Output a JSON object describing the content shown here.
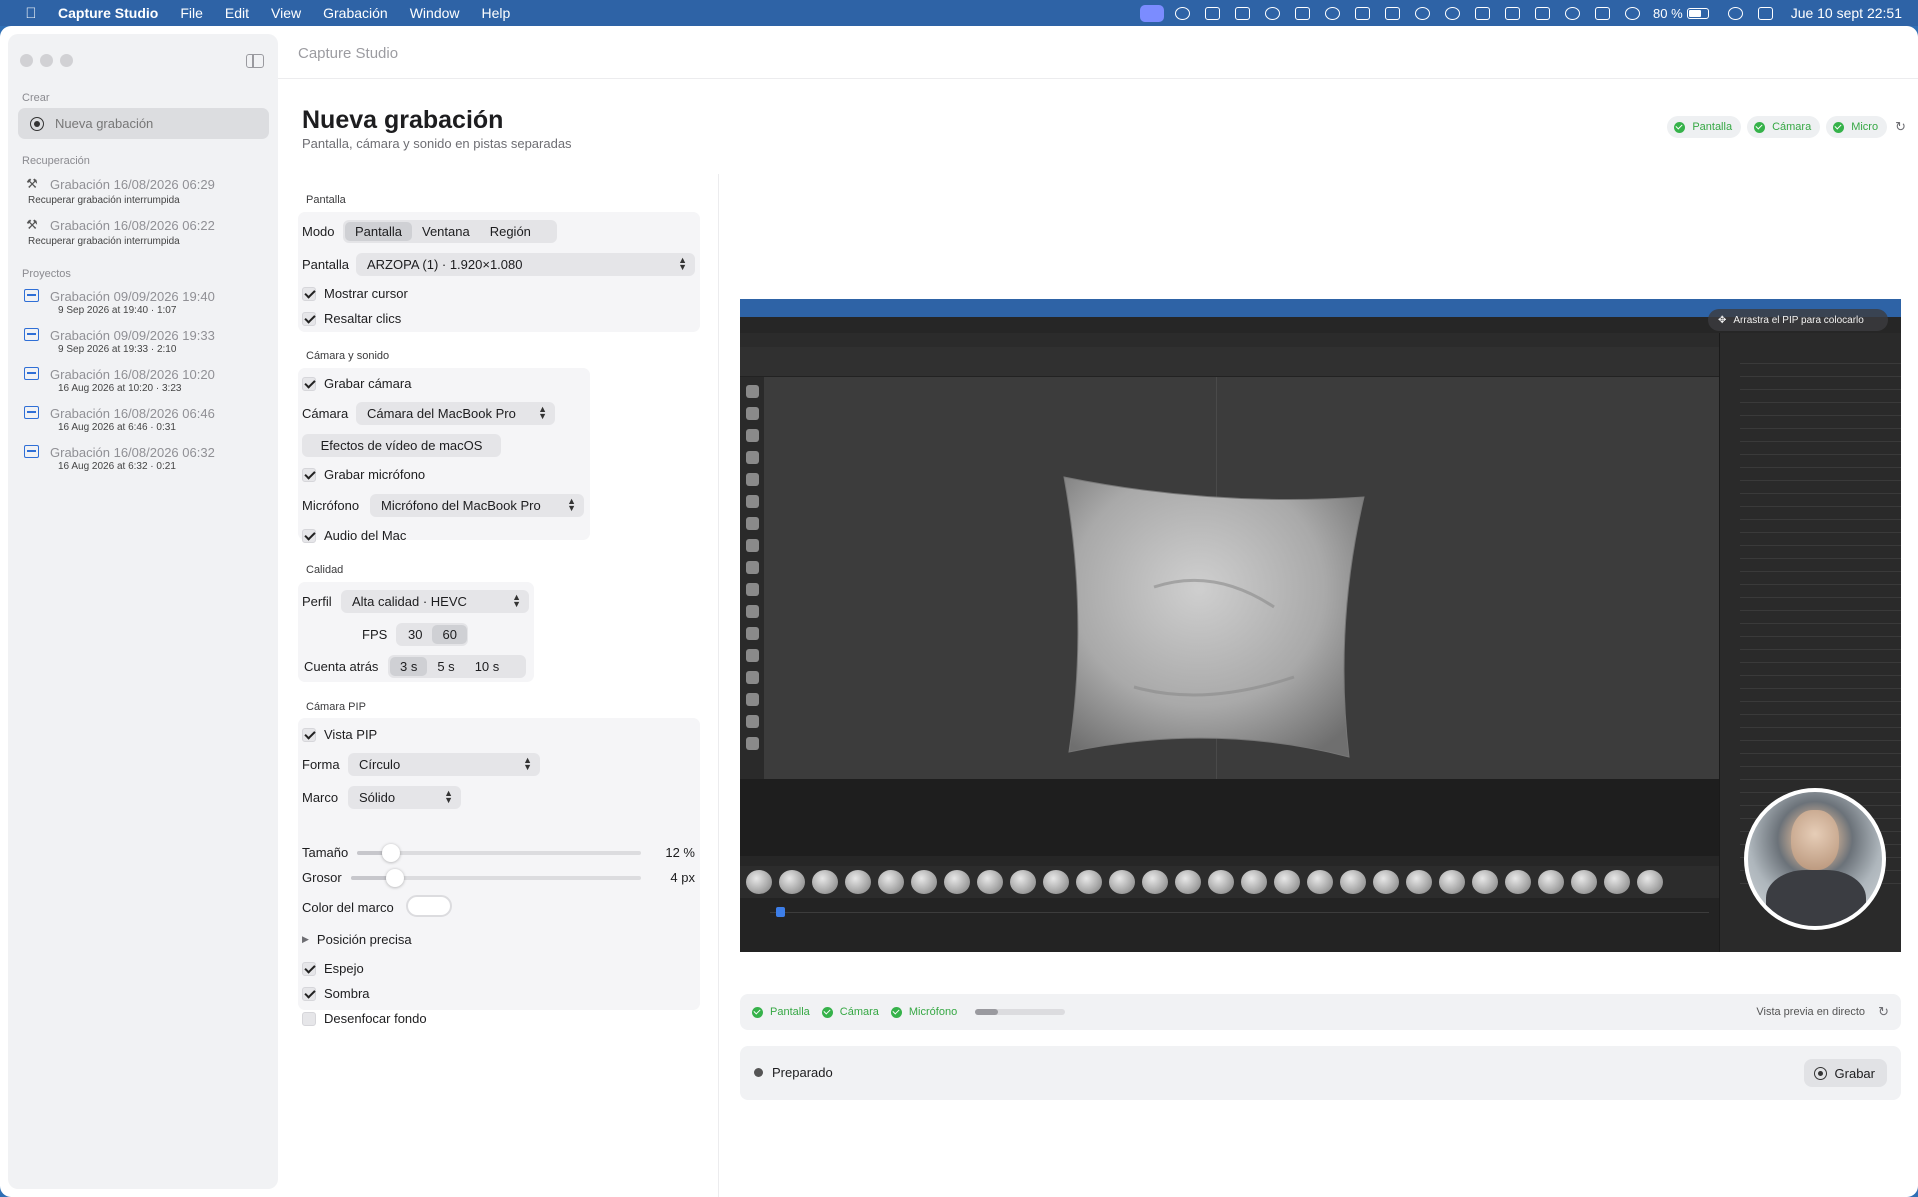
{
  "menubar": {
    "app_name": "Capture Studio",
    "items": [
      "File",
      "Edit",
      "View",
      "Grabación",
      "Window",
      "Help"
    ],
    "battery": "80 %",
    "clock": "Jue 10 sept 22:51"
  },
  "window": {
    "title": "Capture Studio"
  },
  "sidebar": {
    "create_label": "Crear",
    "new_recording": "Nueva grabación",
    "recovery_label": "Recuperación",
    "recovery": [
      {
        "title": "Grabación 16/08/2026 06:29",
        "subtitle": "Recuperar grabación interrumpida"
      },
      {
        "title": "Grabación 16/08/2026 06:22",
        "subtitle": "Recuperar grabación interrumpida"
      }
    ],
    "projects_label": "Proyectos",
    "projects": [
      {
        "title": "Grabación 09/09/2026 19:40",
        "subtitle": "9 Sep 2026 at 19:40 · 1:07"
      },
      {
        "title": "Grabación 09/09/2026 19:33",
        "subtitle": "9 Sep 2026 at 19:33 · 2:10"
      },
      {
        "title": "Grabación 16/08/2026 10:20",
        "subtitle": "16 Aug 2026 at 10:20 · 3:23"
      },
      {
        "title": "Grabación 16/08/2026 06:46",
        "subtitle": "16 Aug 2026 at 6:46 · 0:31"
      },
      {
        "title": "Grabación 16/08/2026 06:32",
        "subtitle": "16 Aug 2026 at 6:32 · 0:21"
      }
    ]
  },
  "header": {
    "title": "Nueva grabación",
    "subtitle": "Pantalla, cámara y sonido en pistas separadas",
    "chips": [
      "Pantalla",
      "Cámara",
      "Micro"
    ]
  },
  "screen": {
    "section": "Pantalla",
    "mode_label": "Modo",
    "modes": [
      "Pantalla",
      "Ventana",
      "Región"
    ],
    "mode_selected": "Pantalla",
    "display_label": "Pantalla",
    "display_value": "ARZOPA (1) · 1.920×1.080",
    "show_cursor": "Mostrar cursor",
    "highlight_clicks": "Resaltar clics"
  },
  "camera_sound": {
    "section": "Cámara y sonido",
    "record_camera": "Grabar cámara",
    "camera_label": "Cámara",
    "camera_value": "Cámara del MacBook Pro",
    "video_effects": "Efectos de vídeo de macOS",
    "record_mic": "Grabar micrófono",
    "mic_label": "Micrófono",
    "mic_value": "Micrófono del MacBook Pro",
    "mac_audio": "Audio del Mac"
  },
  "quality": {
    "section": "Calidad",
    "profile_label": "Perfil",
    "profile_value": "Alta calidad · HEVC",
    "fps_label": "FPS",
    "fps_options": [
      "30",
      "60"
    ],
    "fps_selected": "60",
    "countdown_label": "Cuenta atrás",
    "countdown_options": [
      "3 s",
      "5 s",
      "10 s"
    ],
    "countdown_selected": "3 s"
  },
  "pip": {
    "section": "Cámara PIP",
    "view_pip": "Vista PIP",
    "shape_label": "Forma",
    "shape_value": "Círculo",
    "frame_label": "Marco",
    "frame_value": "Sólido",
    "size_label": "Tamaño",
    "size_value": "12 %",
    "size_level": 0.12,
    "thickness_label": "Grosor",
    "thickness_value": "4 px",
    "thickness_level": 0.15,
    "frame_color_label": "Color del marco",
    "precise_position": "Posición precisa",
    "mirror": "Espejo",
    "shadow": "Sombra",
    "blur_background": "Desenfocar fondo"
  },
  "preview": {
    "pip_hint": "Arrastra el PIP para colocarlo",
    "status_items": [
      "Pantalla",
      "Cámara",
      "Micrófono"
    ],
    "mic_level": 0.25,
    "live_label": "Vista previa en directo",
    "state": "Preparado",
    "record_button": "Grabar"
  }
}
